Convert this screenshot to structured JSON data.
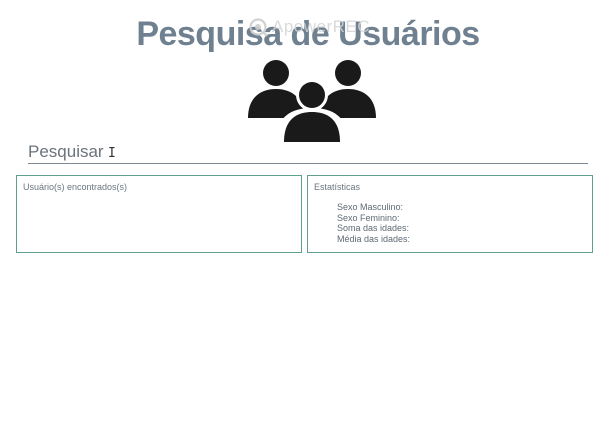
{
  "header": {
    "title": "Pesquisa de Usuários",
    "watermark": "ApowerREC"
  },
  "icons": {
    "users": "users-group-icon",
    "watermark": "record-icon"
  },
  "search": {
    "placeholder": "Pesquisar",
    "value": ""
  },
  "results_panel": {
    "label": "Usuário(s) encontrados(s)"
  },
  "stats_panel": {
    "label": "Estatísticas",
    "items": [
      "Sexo Masculino:",
      "Sexo Feminino:",
      "Soma das idades:",
      "Média das idades:"
    ]
  },
  "colors": {
    "title": "#6f8190",
    "panel_border": "#5f9f8f",
    "search_underline": "#7a8a96",
    "icon": "#1a1a1a"
  }
}
